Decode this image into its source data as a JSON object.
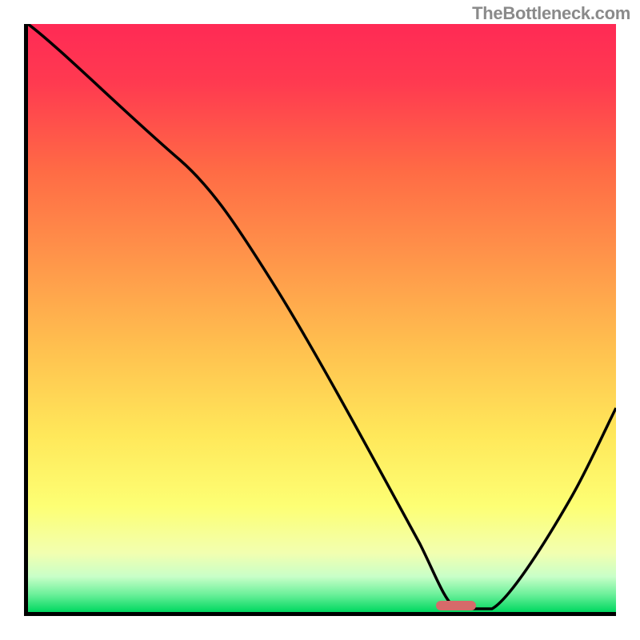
{
  "watermark": "TheBottleneck.com",
  "chart_data": {
    "type": "line",
    "title": "",
    "xlabel": "",
    "ylabel": "",
    "xlim": [
      0,
      100
    ],
    "ylim": [
      0,
      100
    ],
    "series": [
      {
        "name": "bottleneck-curve",
        "x": [
          0,
          8,
          25,
          30,
          40,
          50,
          60,
          68,
          72,
          75,
          80,
          85,
          90,
          100
        ],
        "y": [
          100,
          95,
          78,
          72,
          57,
          42,
          27,
          12,
          3,
          0.5,
          0.5,
          6,
          15,
          34
        ]
      }
    ],
    "marker": {
      "name": "optimal-range",
      "x_start": 72,
      "x_end": 79,
      "y": 0,
      "color": "#d66a6a"
    },
    "background_gradient": {
      "stops": [
        {
          "pos": 0.0,
          "color": "#ff2a55"
        },
        {
          "pos": 0.1,
          "color": "#ff3a50"
        },
        {
          "pos": 0.25,
          "color": "#ff6b45"
        },
        {
          "pos": 0.4,
          "color": "#ff954a"
        },
        {
          "pos": 0.55,
          "color": "#ffc04f"
        },
        {
          "pos": 0.7,
          "color": "#ffe85a"
        },
        {
          "pos": 0.82,
          "color": "#fdff74"
        },
        {
          "pos": 0.9,
          "color": "#f2ffb0"
        },
        {
          "pos": 0.94,
          "color": "#c8ffc8"
        },
        {
          "pos": 0.97,
          "color": "#6cf09a"
        },
        {
          "pos": 1.0,
          "color": "#00d860"
        }
      ]
    }
  }
}
